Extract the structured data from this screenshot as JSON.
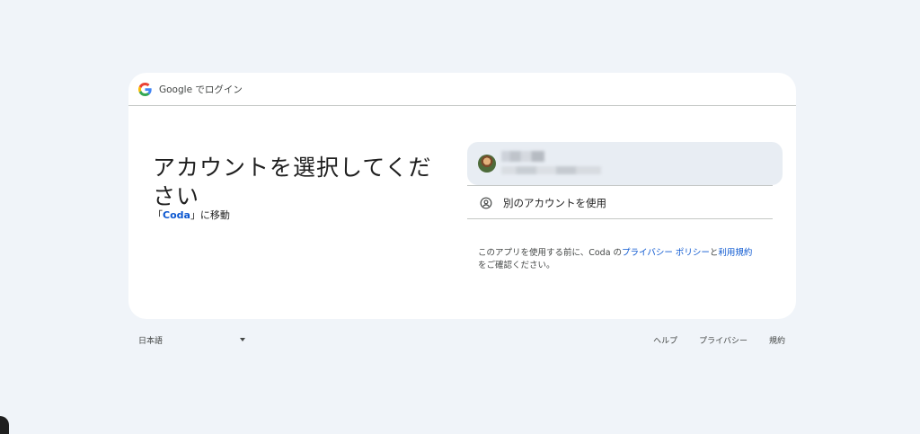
{
  "header": {
    "brand": "Google",
    "text": "でログイン"
  },
  "main": {
    "title": "アカウントを選択してください",
    "continue_prefix": "「",
    "continue_app": "Coda",
    "continue_suffix": "」に移動"
  },
  "accounts": [
    {
      "name": "(blurred)",
      "email": "(blurred)"
    }
  ],
  "other_account": {
    "label": "別のアカウントを使用",
    "icon": "person-circle-icon"
  },
  "disclaimer": {
    "before": "このアプリを使用する前に、Coda の",
    "privacy_link": "プライバシー ポリシー",
    "and": "と",
    "terms_link": "利用規約",
    "after": "をご確認ください。"
  },
  "footer": {
    "language": "日本語",
    "help": "ヘルプ",
    "privacy": "プライバシー",
    "terms": "規約"
  },
  "colors": {
    "background": "#f0f4f9",
    "card": "#ffffff",
    "link": "#0b57d0",
    "account_highlight": "#e8edf3"
  }
}
